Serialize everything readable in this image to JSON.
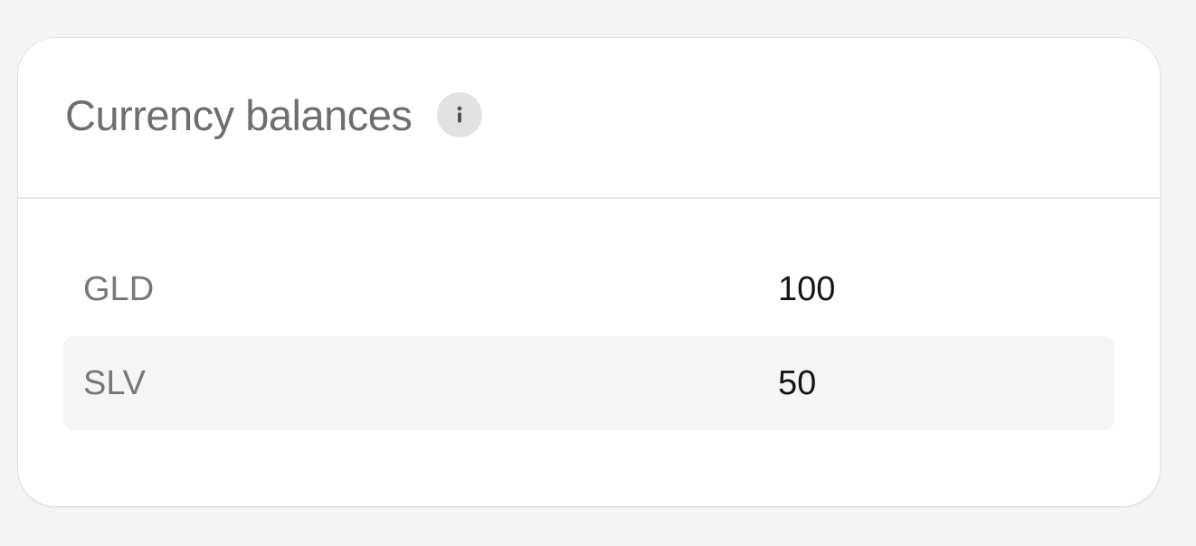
{
  "card": {
    "title": "Currency balances",
    "info_icon": "info-icon"
  },
  "balances": [
    {
      "code": "GLD",
      "amount": "100"
    },
    {
      "code": "SLV",
      "amount": "50"
    }
  ],
  "colors": {
    "page_background": "#f4f4f4",
    "card_background": "#ffffff",
    "title_text": "#6e6e6e",
    "code_text": "#777777",
    "amount_text": "#141414",
    "alt_row_background": "#f5f5f5",
    "divider": "#e6e6e6"
  }
}
